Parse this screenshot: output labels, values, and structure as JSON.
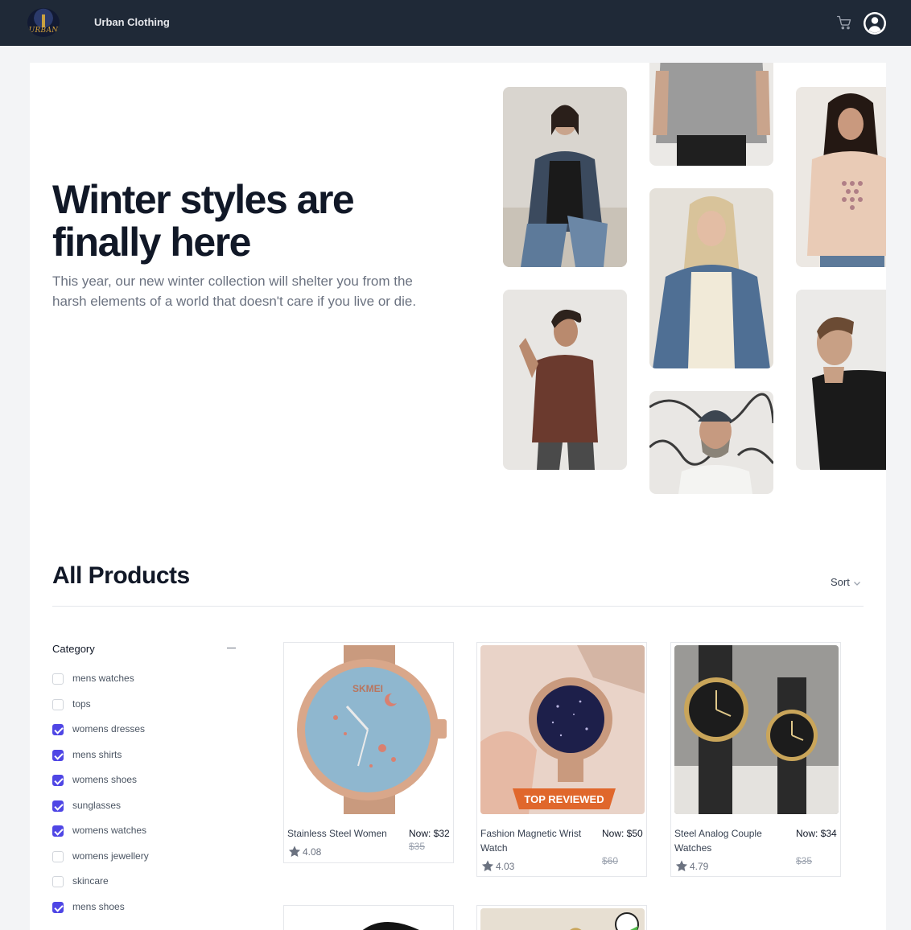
{
  "nav": {
    "brand": "Urban Clothing",
    "logo_text": "URBAN",
    "icons": {
      "cart": "cart-icon",
      "user": "user-icon"
    }
  },
  "hero": {
    "title": "Winter styles are finally here",
    "subtitle": "This year, our new winter collection will shelter you from the harsh elements of a world that doesn't care if you live or die."
  },
  "products": {
    "title": "All Products",
    "sort_label": "Sort"
  },
  "filters": {
    "category_label": "Category",
    "items": [
      {
        "label": "mens watches",
        "checked": false
      },
      {
        "label": "tops",
        "checked": false
      },
      {
        "label": "womens dresses",
        "checked": true
      },
      {
        "label": "mens shirts",
        "checked": true
      },
      {
        "label": "womens shoes",
        "checked": true
      },
      {
        "label": "sunglasses",
        "checked": true
      },
      {
        "label": "womens watches",
        "checked": true
      },
      {
        "label": "womens jewellery",
        "checked": false
      },
      {
        "label": "skincare",
        "checked": false
      },
      {
        "label": "mens shoes",
        "checked": true
      }
    ]
  },
  "cards": [
    {
      "name": "Stainless Steel Women",
      "now": "Now: $32",
      "was": "$35",
      "rating": "4.08"
    },
    {
      "name": "Fashion Magnetic Wrist Watch",
      "now": "Now: $50",
      "was": "$60",
      "rating": "4.03",
      "badge": "TOP REVIEWED"
    },
    {
      "name": "Steel Analog Couple Watches",
      "now": "Now: $34",
      "was": "$35",
      "rating": "4.79"
    }
  ],
  "colors": {
    "nav_bg": "#1f2937",
    "accent": "#4f46e5",
    "page_bg": "#f3f4f6"
  }
}
